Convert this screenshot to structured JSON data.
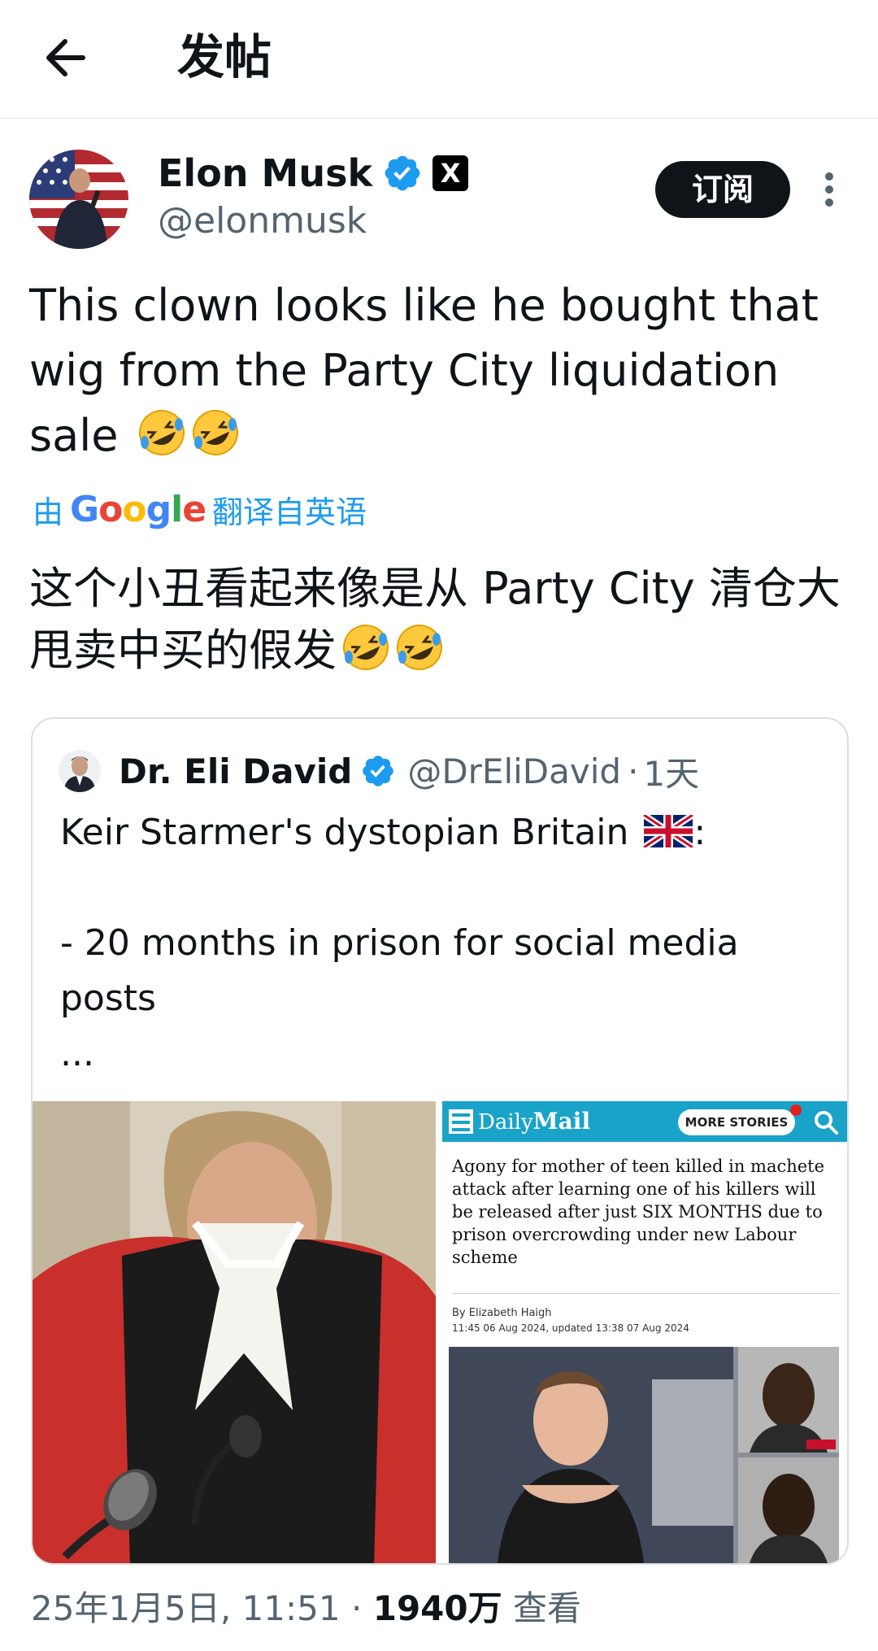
{
  "header": {
    "title": "发帖"
  },
  "author": {
    "name": "Elon Musk",
    "handle": "@elonmusk",
    "x_badge": "X"
  },
  "subscribe_label": "订阅",
  "tweet": {
    "text": "This clown looks like he bought that wig from the Party City liquidation sale"
  },
  "translation": {
    "prefix": "由",
    "brand": "Google",
    "suffix": "翻译自英语",
    "text": "这个小丑看起来像是从 Party City 清仓大甩卖中买的假发"
  },
  "quote": {
    "name": "Dr. Eli David",
    "handle": "@DrEliDavid",
    "separator": "·",
    "age": "1天",
    "text": "Keir Starmer's dystopian Britain",
    "text_rest": ":\n\n- 20 months in prison for social media posts\n...",
    "article": {
      "logo_a": "Daily",
      "logo_b": "Mail",
      "more_label": "MORE STORIES",
      "headline": "Agony for mother of teen killed in machete attack after learning one of his killers will be released after just SIX MONTHS due to prison overcrowding under new Labour scheme",
      "byline": "By Elizabeth Haigh",
      "date": "11:45 06 Aug 2024, updated 13:38 07 Aug 2024"
    }
  },
  "meta": {
    "date": "25年1月5日, 11:51",
    "separator": "·",
    "views": "1940万",
    "views_label": "查看"
  },
  "colors": {
    "accent": "#1d9bf0",
    "secondary_text": "#536471",
    "dailymail_bar": "#1aa3c8"
  },
  "icons": [
    "back-arrow-icon",
    "verified-icon",
    "x-logo-icon",
    "more-vertical-icon",
    "rofl-emoji-icon",
    "uk-flag-icon",
    "search-icon",
    "menu-icon"
  ]
}
